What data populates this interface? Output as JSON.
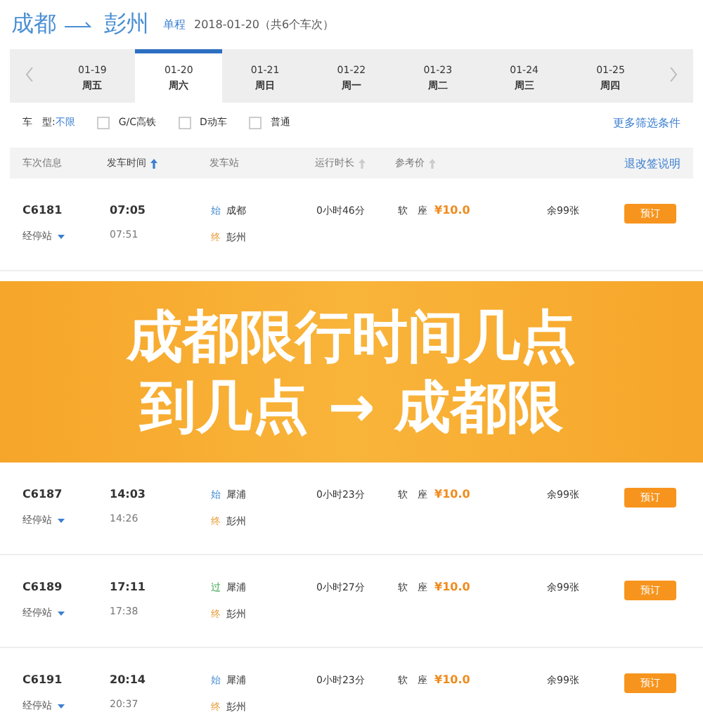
{
  "route": {
    "from": "成都",
    "to": "彭州",
    "trip_type": "单程",
    "summary": "2018-01-20（共6个车次）"
  },
  "dates": [
    {
      "date": "01-19",
      "weekday": "周五",
      "selected": false
    },
    {
      "date": "01-20",
      "weekday": "周六",
      "selected": true
    },
    {
      "date": "01-21",
      "weekday": "周日",
      "selected": false
    },
    {
      "date": "01-22",
      "weekday": "周一",
      "selected": false
    },
    {
      "date": "01-23",
      "weekday": "周二",
      "selected": false
    },
    {
      "date": "01-24",
      "weekday": "周三",
      "selected": false
    },
    {
      "date": "01-25",
      "weekday": "周四",
      "selected": false
    }
  ],
  "filters": {
    "label": "车　型:",
    "any": "不限",
    "options": [
      {
        "label": "G/C高铁",
        "checked": false
      },
      {
        "label": "D动车",
        "checked": false
      },
      {
        "label": "普通",
        "checked": false
      }
    ],
    "more": "更多筛选条件"
  },
  "table": {
    "columns": [
      {
        "label": "车次信息",
        "sortable": false,
        "selected": false
      },
      {
        "label": "发车时间",
        "sortable": true,
        "selected": true
      },
      {
        "label": "发车站",
        "sortable": false,
        "selected": false
      },
      {
        "label": "运行时长",
        "sortable": true,
        "selected": false
      },
      {
        "label": "参考价",
        "sortable": true,
        "selected": false
      }
    ],
    "policy_link": "退改签说明",
    "rows": [
      {
        "train": "C6181",
        "stops": "经停站",
        "depart": "07:05",
        "arrive": "07:51",
        "from_tag": {
          "text": "始",
          "kind": "start"
        },
        "from": "成都",
        "to_tag": {
          "text": "终",
          "kind": "end"
        },
        "to": "彭州",
        "duration": "0小时46分",
        "seat": "软　座",
        "price": "¥10.0",
        "remaining": "余99张",
        "button": "预订"
      }
    ]
  },
  "banner": {
    "lines": [
      "成都限行时间几点",
      "到几点 → 成都限"
    ]
  },
  "rows_below": [
    {
      "train": "C6187",
      "stops": "经停站",
      "depart": "14:03",
      "arrive": "14:26",
      "from_tag": {
        "text": "始",
        "kind": "start"
      },
      "from": "犀浦",
      "to_tag": {
        "text": "终",
        "kind": "end"
      },
      "to": "彭州",
      "duration": "0小时23分",
      "seat": "软　座",
      "price": "¥10.0",
      "remaining": "余99张",
      "button": "预订"
    },
    {
      "train": "C6189",
      "stops": "经停站",
      "depart": "17:11",
      "arrive": "17:38",
      "from_tag": {
        "text": "过",
        "kind": "pass"
      },
      "from": "犀浦",
      "to_tag": {
        "text": "终",
        "kind": "end"
      },
      "to": "彭州",
      "duration": "0小时27分",
      "seat": "软　座",
      "price": "¥10.0",
      "remaining": "余99张",
      "button": "预订"
    },
    {
      "train": "C6191",
      "stops": "经停站",
      "depart": "20:14",
      "arrive": "20:37",
      "from_tag": {
        "text": "始",
        "kind": "start"
      },
      "from": "犀浦",
      "to_tag": {
        "text": "终",
        "kind": "end"
      },
      "to": "彭州",
      "duration": "0小时23分",
      "seat": "软　座",
      "price": "¥10.0",
      "remaining": "余99张",
      "button": "预订"
    }
  ]
}
